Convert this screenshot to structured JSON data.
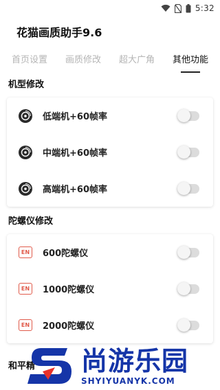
{
  "status_bar": {
    "time": "5:32"
  },
  "app": {
    "title": "花猫画质助手9.6"
  },
  "tabs": [
    {
      "label": "首页设置",
      "active": false
    },
    {
      "label": "画质修改",
      "active": false
    },
    {
      "label": "超大广角",
      "active": false
    },
    {
      "label": "其他功能",
      "active": true
    }
  ],
  "sections": {
    "model": {
      "title": "机型修改",
      "items": [
        {
          "label": "低端机+60帧率",
          "icon": "disc-icon",
          "enabled": false
        },
        {
          "label": "中端机+60帧率",
          "icon": "disc-icon",
          "enabled": false
        },
        {
          "label": "高端机+60帧率",
          "icon": "disc-icon",
          "enabled": false
        }
      ]
    },
    "gyro": {
      "title": "陀螺仪修改",
      "items": [
        {
          "label": "600陀螺仪",
          "icon": "en-badge-icon",
          "enabled": false
        },
        {
          "label": "1000陀螺仪",
          "icon": "en-badge-icon",
          "enabled": false
        },
        {
          "label": "2000陀螺仪",
          "icon": "en-badge-icon",
          "enabled": false
        }
      ]
    },
    "bottom": {
      "title": "和平精"
    }
  },
  "badge": {
    "text": "EN"
  },
  "watermark": {
    "cn": "尚游乐园",
    "en": "SHYIYUANYK.COM"
  },
  "colors": {
    "accent_red": "#e05a4a",
    "watermark_blue": "#1535a8",
    "watermark_red": "#e8322a",
    "toggle_off": "#dcdcdc"
  }
}
